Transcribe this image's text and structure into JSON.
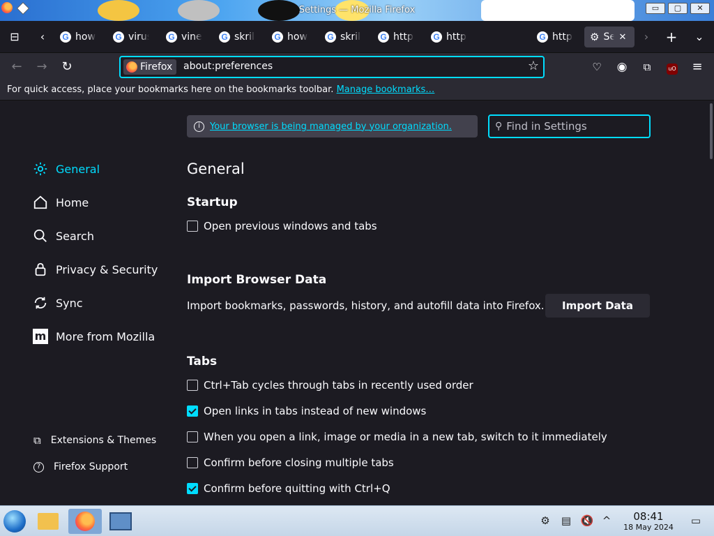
{
  "window": {
    "title": "Settings — Mozilla Firefox",
    "controls": [
      "▭",
      "▢",
      "✕"
    ]
  },
  "tabs": [
    {
      "label": "how"
    },
    {
      "label": "virus"
    },
    {
      "label": "vine"
    },
    {
      "label": "skrill"
    },
    {
      "label": "how"
    },
    {
      "label": "skrill"
    },
    {
      "label": "https"
    },
    {
      "label": "https"
    },
    {
      "label": "https"
    }
  ],
  "active_tab": {
    "label": "Settings"
  },
  "navbar": {
    "identity_label": "Firefox",
    "url": "about:preferences"
  },
  "bookmarks_bar": {
    "text": "For quick access, place your bookmarks here on the bookmarks toolbar.",
    "link": "Manage bookmarks…"
  },
  "managed_notice": "Your browser is being managed by your organization.",
  "search": {
    "placeholder": "Find in Settings"
  },
  "sidebar": {
    "items": [
      {
        "label": "General",
        "icon": "gear-icon"
      },
      {
        "label": "Home",
        "icon": "home-icon"
      },
      {
        "label": "Search",
        "icon": "search-icon"
      },
      {
        "label": "Privacy & Security",
        "icon": "lock-icon"
      },
      {
        "label": "Sync",
        "icon": "sync-icon"
      },
      {
        "label": "More from Mozilla",
        "icon": "mozilla-icon"
      }
    ],
    "footer": [
      {
        "label": "Extensions & Themes",
        "icon": "puzzle-icon"
      },
      {
        "label": "Firefox Support",
        "icon": "help-icon"
      }
    ]
  },
  "main": {
    "title": "General",
    "startup": {
      "heading": "Startup",
      "option": "Open previous windows and tabs",
      "checked": false
    },
    "import": {
      "heading": "Import Browser Data",
      "description": "Import bookmarks, passwords, history, and autofill data into Firefox.",
      "button": "Import Data"
    },
    "tabs_section": {
      "heading": "Tabs",
      "options": [
        {
          "label": "Ctrl+Tab cycles through tabs in recently used order",
          "checked": false
        },
        {
          "label": "Open links in tabs instead of new windows",
          "checked": true
        },
        {
          "label": "When you open a link, image or media in a new tab, switch to it immediately",
          "checked": false
        },
        {
          "label": "Confirm before closing multiple tabs",
          "checked": false
        },
        {
          "label": "Confirm before quitting with Ctrl+Q",
          "checked": true
        }
      ]
    }
  },
  "taskbar": {
    "time": "08:41",
    "date": "18 May 2024"
  },
  "colors": {
    "accent": "#00ddff",
    "bg": "#1c1b22",
    "panel": "#2b2a33"
  }
}
